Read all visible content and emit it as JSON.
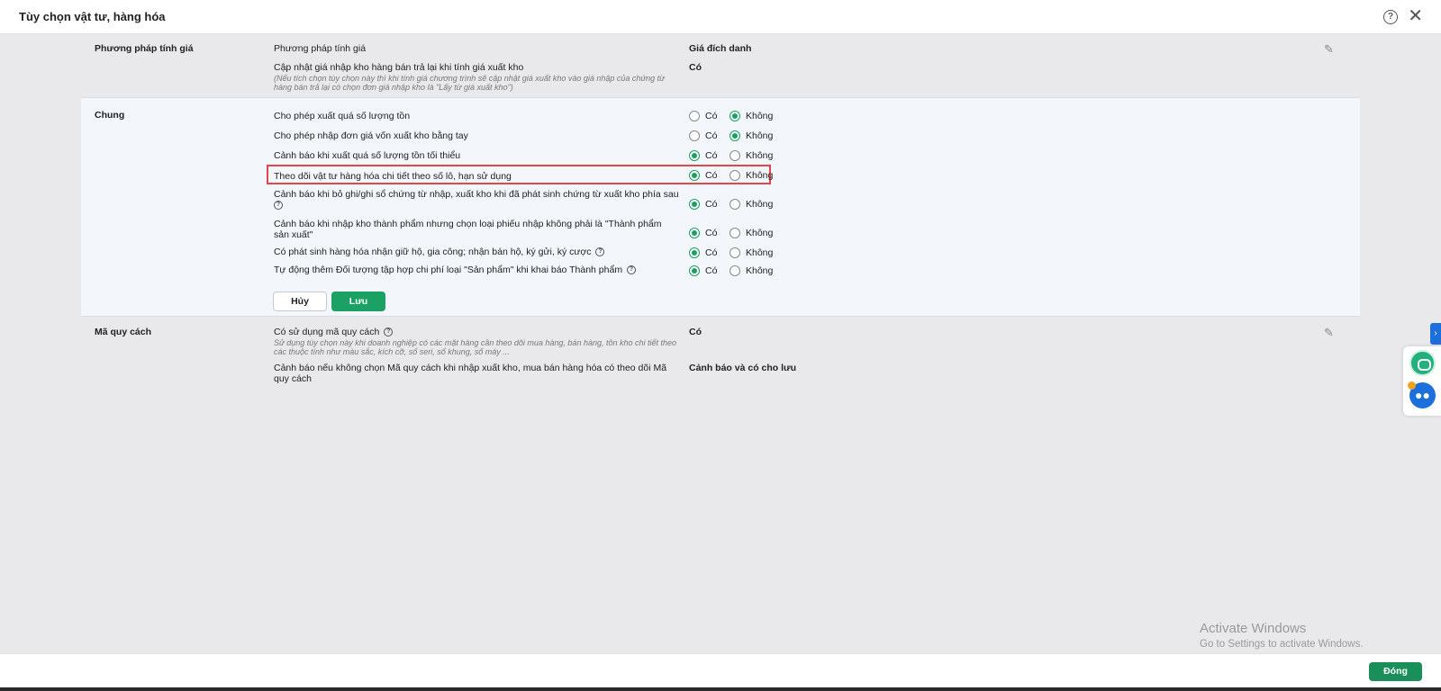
{
  "window": {
    "title": "Tùy chọn vật tư, hàng hóa",
    "help_glyph": "?",
    "close_glyph": "✕"
  },
  "sections": {
    "pricing": {
      "label": "Phương pháp tính giá",
      "rows": [
        {
          "label": "Phương pháp tính giá",
          "value": "Giá đích danh"
        },
        {
          "label": "Cập nhật giá nhập kho hàng bán trả lại khi tính giá xuất kho",
          "hint": "(Nếu tích chọn tùy chọn này thì khi tính giá chương trình sẽ cập nhật giá xuất kho vào giá nhập của chứng từ hàng bán trả lại có chọn đơn giá nhập kho là \"Lấy từ giá xuất kho\")",
          "value": "Có"
        }
      ]
    },
    "general": {
      "label": "Chung",
      "option_yes": "Có",
      "option_no": "Không",
      "rows": [
        {
          "label": "Cho phép xuất quá số lượng tồn",
          "selected": "no"
        },
        {
          "label": "Cho phép nhập đơn giá vốn xuất kho bằng tay",
          "selected": "no"
        },
        {
          "label": "Cảnh báo khi xuất quá số lượng tồn tối thiểu",
          "selected": "yes"
        },
        {
          "label": "Theo dõi vật tư hàng hóa chi tiết theo số lô, hạn sử dụng",
          "selected": "yes"
        },
        {
          "label": "Cảnh báo khi bỏ ghi/ghi sổ chứng từ nhập, xuất kho khi đã phát sinh chứng từ xuất kho phía sau",
          "selected": "yes"
        },
        {
          "label": "Cảnh báo khi nhập kho thành phẩm nhưng chọn loại phiếu nhập không phải là \"Thành phẩm sản xuất\"",
          "selected": "yes"
        },
        {
          "label": "Có phát sinh hàng hóa nhận giữ hộ, gia công; nhận bán hộ, ký gửi, ký cược",
          "selected": "yes"
        },
        {
          "label": "Tự động thêm Đối tượng tập hợp chi phí loại \"Sản phẩm\" khi khai báo Thành phẩm",
          "selected": "yes"
        }
      ],
      "cancel_label": "Hủy",
      "save_label": "Lưu"
    },
    "spec": {
      "label": "Mã quy cách",
      "rows": [
        {
          "label": "Có sử dụng mã quy cách",
          "hint": "Sử dụng tùy chọn này khi doanh nghiệp có các mặt hàng cần theo dõi mua hàng, bán hàng, tồn kho chi tiết theo các thuộc tính như màu sắc, kích cỡ, số seri, số khung, số máy ...",
          "value": "Có"
        },
        {
          "label": "Cảnh báo nếu không chọn Mã quy cách khi nhập xuất kho, mua bán hàng hóa có theo dõi Mã quy cách",
          "value": "Cảnh báo và có cho lưu"
        }
      ]
    }
  },
  "footer": {
    "close_label": "Đóng"
  },
  "watermark": {
    "line1": "Activate Windows",
    "line2": "Go to Settings to activate Windows."
  },
  "side_widget": {
    "tab_glyph": "›",
    "icons": [
      "chat-icon",
      "group-icon"
    ]
  },
  "colors": {
    "accent": "#1aa163",
    "highlight": "#e0474c",
    "section_bg": "#f3f6fb"
  }
}
